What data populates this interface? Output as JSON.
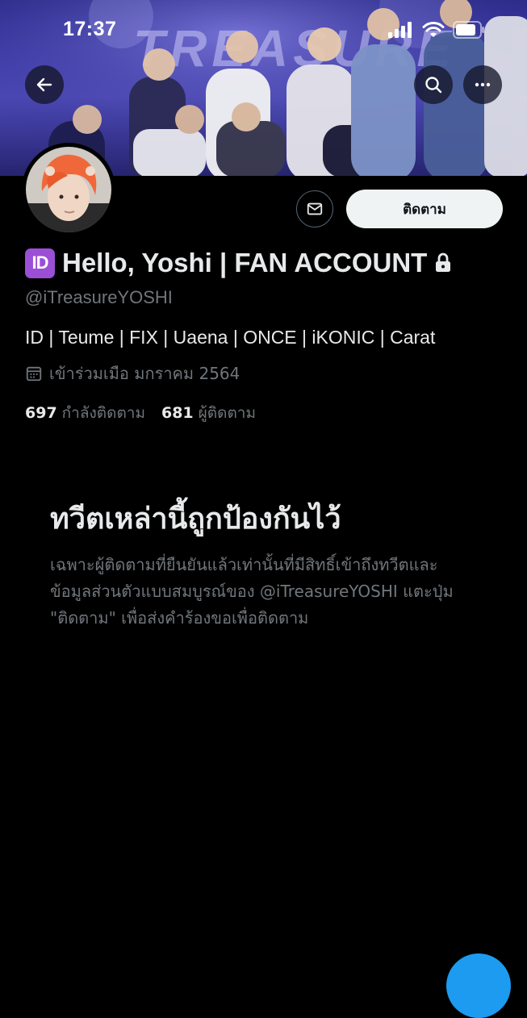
{
  "status_bar": {
    "time": "17:37"
  },
  "banner": {
    "text": "TREASURE"
  },
  "header": {
    "back_icon": "arrow-left-icon",
    "search_icon": "search-icon",
    "more_icon": "more-horizontal-icon"
  },
  "profile": {
    "badge": "ID",
    "display_name": "Hello, Yoshi | FAN ACCOUNT",
    "handle": "@iTreasureYOSHI",
    "bio": "ID | Teume | FIX | Uaena | ONCE | iKONIC | Carat",
    "joined": "เข้าร่วมเมือ มกราคม 2564",
    "following_count": "697",
    "following_label": "กำลังติดตาม",
    "followers_count": "681",
    "followers_label": "ผู้ติดตาม"
  },
  "actions": {
    "follow_label": "ติดตาม"
  },
  "protected": {
    "title": "ทวีตเหล่านี้ถูกป้องกันไว้",
    "description": "เฉพาะผู้ติดตามที่ยืนยันแล้วเท่านั้นที่มีสิทธิ์เข้าถึงทวีตและข้อมูลส่วนตัวแบบสมบูรณ์ของ @iTreasureYOSHI แตะปุ่ม \"ติดตาม\" เพื่อส่งคำร้องขอเพื่อติดตาม"
  },
  "colors": {
    "background": "#000000",
    "text_primary": "#e7e9ea",
    "text_secondary": "#71767b",
    "accent": "#1d9bf0",
    "badge": "#9a4fd6"
  }
}
